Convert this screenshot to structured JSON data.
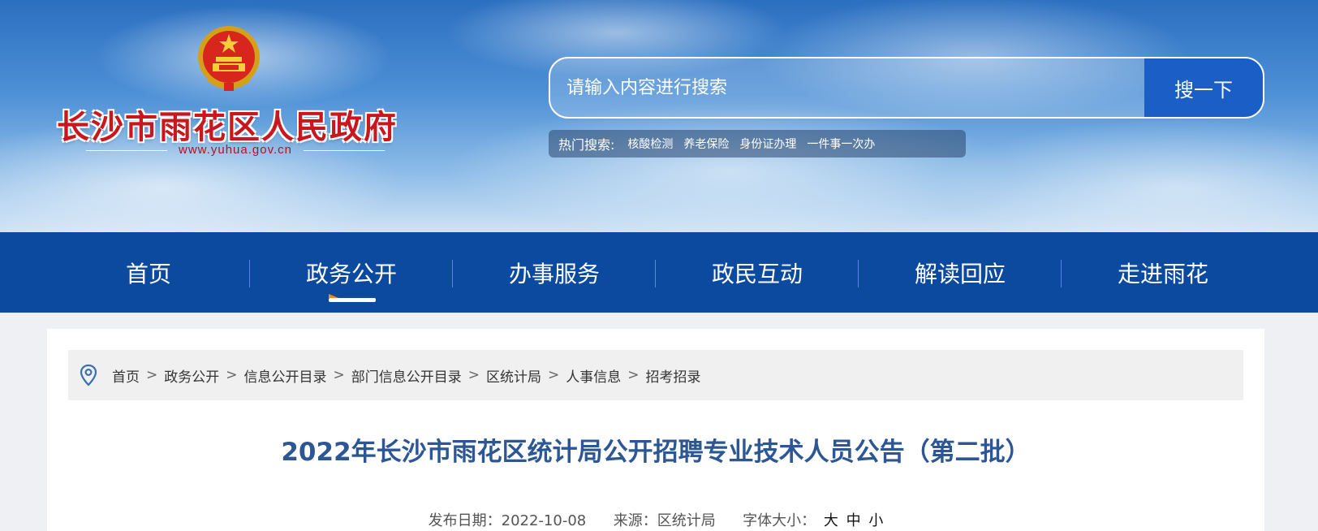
{
  "header": {
    "site_title": "长沙市雨花区人民政府",
    "site_url": "www.yuhua.gov.cn",
    "emblem_icon": "national-emblem-icon"
  },
  "search": {
    "placeholder": "请输入内容进行搜索",
    "button_label": "搜一下",
    "button_color": "#1b5fc6"
  },
  "hot_search": {
    "label": "热门搜索:",
    "items": [
      "核酸检测",
      "养老保险",
      "身份证办理",
      "一件事一次办"
    ]
  },
  "nav": {
    "items": [
      {
        "label": "首页"
      },
      {
        "label": "政务公开"
      },
      {
        "label": "办事服务"
      },
      {
        "label": "政民互动"
      },
      {
        "label": "解读回应"
      },
      {
        "label": "走进雨花"
      }
    ],
    "active_index": 1,
    "background": "#0c4aa0"
  },
  "breadcrumb": {
    "items": [
      "首页",
      "政务公开",
      "信息公开目录",
      "部门信息公开目录",
      "区统计局",
      "人事信息",
      "招考招录"
    ],
    "separator": ">",
    "icon": "location-pin-icon"
  },
  "article": {
    "title": "2022年长沙市雨花区统计局公开招聘专业技术人员公告（第二批）",
    "title_color": "#2c5694",
    "date_label": "发布日期：",
    "date": "2022-10-08",
    "source_label": "来源：",
    "source": "区统计局",
    "font_size_label": "字体大小：",
    "font_sizes": [
      "大",
      "中",
      "小"
    ]
  }
}
